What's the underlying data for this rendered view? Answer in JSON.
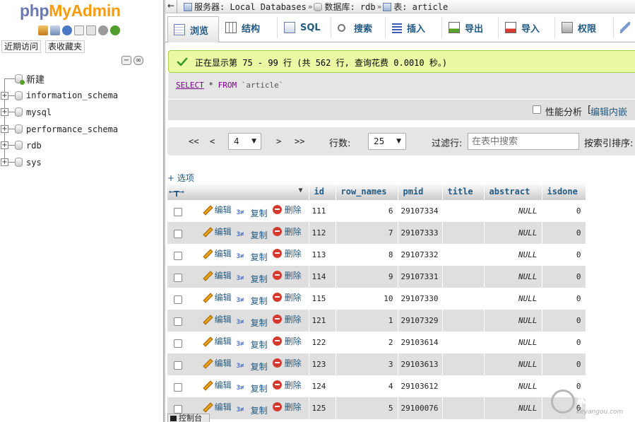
{
  "logo": {
    "php": "php",
    "my": "My",
    "admin": "Admin"
  },
  "nav": {
    "tabs": [
      "近期访问",
      "表收藏夹"
    ],
    "new_label": "新建",
    "databases": [
      "information_schema",
      "mysql",
      "performance_schema",
      "rdb",
      "sys"
    ]
  },
  "breadcrumb": {
    "server_label": "服务器: Local Databases",
    "database_label": "数据库: rdb",
    "table_label": "表: article",
    "separator": "»",
    "collapse_glyph": "←"
  },
  "tabs": [
    {
      "label": "浏览",
      "icon": "browse-icon",
      "active": true
    },
    {
      "label": "结构",
      "icon": "structure-icon"
    },
    {
      "label": "SQL",
      "icon": "sql-icon"
    },
    {
      "label": "搜索",
      "icon": "search-icon"
    },
    {
      "label": "插入",
      "icon": "insert-icon"
    },
    {
      "label": "导出",
      "icon": "export-icon"
    },
    {
      "label": "导入",
      "icon": "import-icon"
    },
    {
      "label": "权限",
      "icon": "privileges-icon"
    }
  ],
  "success": {
    "message": "正在显示第 75 - 99 行 (共 562 行, 查询花费 0.0010 秒。)"
  },
  "sql": {
    "select": "SELECT",
    "rest": " * ",
    "from": "FROM",
    "table": " `article`"
  },
  "profiling": {
    "label": "性能分析",
    "bracket": "[",
    "inline_edit": "编辑内嵌"
  },
  "pager": {
    "first": "<<",
    "prev": "<",
    "page": "4",
    "next": ">",
    "last": ">>",
    "rows_label": "行数:",
    "rows_value": "25",
    "filter_label": "过滤行:",
    "filter_placeholder": "在表中搜索",
    "sort_label": "按索引排序:"
  },
  "results": {
    "options_link": "+ 选项",
    "columns": [
      "id",
      "row_names",
      "pmid",
      "title",
      "abstract",
      "isdone"
    ],
    "actions": {
      "edit": "编辑",
      "copy": "复制",
      "delete": "删除"
    },
    "rows": [
      {
        "id": "111",
        "row_names": "6",
        "pmid": "29107334",
        "title": "",
        "abstract": "NULL",
        "isdone": "0"
      },
      {
        "id": "112",
        "row_names": "7",
        "pmid": "29107333",
        "title": "",
        "abstract": "NULL",
        "isdone": "0"
      },
      {
        "id": "113",
        "row_names": "8",
        "pmid": "29107332",
        "title": "",
        "abstract": "NULL",
        "isdone": "0"
      },
      {
        "id": "114",
        "row_names": "9",
        "pmid": "29107331",
        "title": "",
        "abstract": "NULL",
        "isdone": "0"
      },
      {
        "id": "115",
        "row_names": "10",
        "pmid": "29107330",
        "title": "",
        "abstract": "NULL",
        "isdone": "0"
      },
      {
        "id": "121",
        "row_names": "1",
        "pmid": "29107329",
        "title": "",
        "abstract": "NULL",
        "isdone": "0"
      },
      {
        "id": "122",
        "row_names": "2",
        "pmid": "29103614",
        "title": "",
        "abstract": "NULL",
        "isdone": "0"
      },
      {
        "id": "123",
        "row_names": "3",
        "pmid": "29103613",
        "title": "",
        "abstract": "NULL",
        "isdone": "0"
      },
      {
        "id": "124",
        "row_names": "4",
        "pmid": "29103612",
        "title": "",
        "abstract": "NULL",
        "isdone": "0"
      },
      {
        "id": "125",
        "row_names": "5",
        "pmid": "29100076",
        "title": "",
        "abstract": "NULL",
        "isdone": "0"
      }
    ]
  },
  "console": {
    "label": "控制台"
  },
  "watermark": {
    "text": "科研狗",
    "sub": "keyangou.com"
  },
  "colors": {
    "link": "#235a81",
    "success_bg": "#ebf8a4",
    "success_border": "#a2d246",
    "row_alt": "#dfdfdf"
  }
}
